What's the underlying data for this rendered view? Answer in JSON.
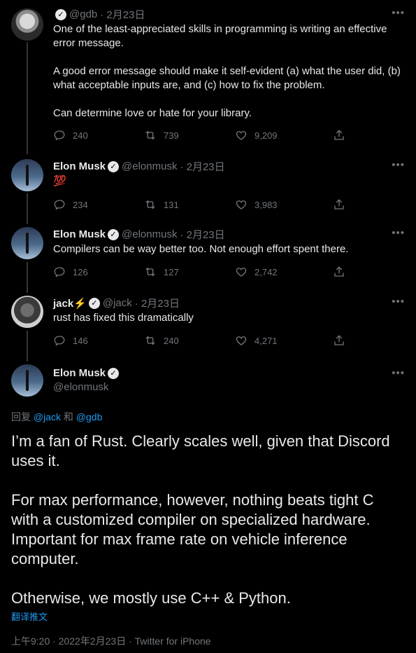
{
  "tweets": [
    {
      "name": "",
      "handle": "@gdb",
      "date": "· 2月23日",
      "lines": [
        "One of the least-appreciated skills in programming is writing an effective error message.",
        "A good error message should make it self-evident (a) what the user did, (b) what acceptable inputs are, and (c) how to fix the problem.",
        "Can determine love or hate for your library."
      ],
      "replies": "240",
      "retweets": "739",
      "likes": "9,209"
    },
    {
      "name": "Elon Musk",
      "handle": "@elonmusk",
      "date": "· 2月23日",
      "text": "💯",
      "replies": "234",
      "retweets": "131",
      "likes": "3,983"
    },
    {
      "name": "Elon Musk",
      "handle": "@elonmusk",
      "date": "· 2月23日",
      "text": "Compilers can be way better too. Not enough effort spent there.",
      "replies": "126",
      "retweets": "127",
      "likes": "2,742"
    },
    {
      "name": "jack⚡️",
      "handle": "@jack",
      "date": "· 2月23日",
      "text": "rust has fixed this dramatically",
      "replies": "146",
      "retweets": "240",
      "likes": "4,271"
    }
  ],
  "main": {
    "name": "Elon Musk",
    "handle": "@elonmusk",
    "reply_prefix": "回复 ",
    "mention1": "@jack",
    "and": " 和 ",
    "mention2": "@gdb",
    "paragraphs": [
      "I’m a fan of Rust. Clearly scales well, given that Discord uses it.",
      "For max performance, however, nothing beats tight C with a customized compiler on specialized hardware. Important for max frame rate on vehicle inference computer.",
      "Otherwise, we mostly use C++ & Python."
    ],
    "translate": "翻译推文",
    "meta": "上午9:20 · 2022年2月23日 · Twitter for iPhone"
  },
  "icons": {
    "more": "more-icon",
    "reply": "reply-icon",
    "retweet": "retweet-icon",
    "like": "like-icon",
    "share": "share-icon",
    "verified": "verified-badge-icon"
  },
  "colors": {
    "background": "#000000",
    "text": "#e7e9ea",
    "muted": "#71767b",
    "link": "#1d9bf0"
  }
}
